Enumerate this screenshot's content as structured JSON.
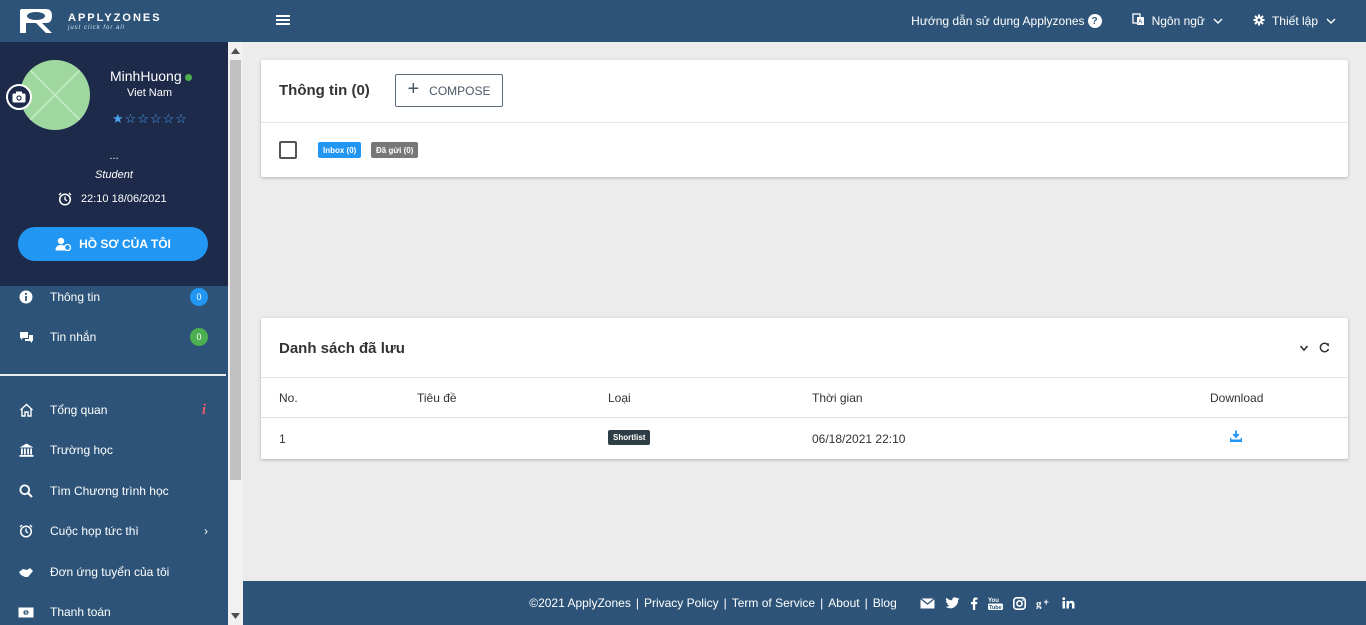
{
  "header": {
    "logo_name": "APPLYZONES",
    "logo_tagline": "just click for all",
    "guide_label": "Hướng dẫn sử dụng Applyzones",
    "language_label": "Ngôn ngữ",
    "settings_label": "Thiết lập"
  },
  "profile": {
    "name": "MinhHuong",
    "country": "Viet Nam",
    "rating": "★☆☆☆☆☆",
    "dots": "...",
    "role": "Student",
    "datetime": "22:10 18/06/2021",
    "button_label": "HỒ SƠ CỦA TÔI"
  },
  "sidebar": {
    "items": [
      {
        "label": "Thông tin",
        "badge": "0",
        "badge_color": "#2196f3"
      },
      {
        "label": "Tin nhắn",
        "badge": "0",
        "badge_color": "#4caf50"
      },
      {
        "label": "Tổng quan",
        "marker": "i"
      },
      {
        "label": "Trường học"
      },
      {
        "label": "Tìm Chương trình học"
      },
      {
        "label": "Cuộc họp tức thì",
        "arrow": "›"
      },
      {
        "label": "Đơn ứng tuyển của tôi"
      },
      {
        "label": "Thanh toán"
      }
    ]
  },
  "messages": {
    "title": "Thông tin (0)",
    "compose_label": "COMPOSE",
    "inbox_label": "Inbox (0)",
    "sent_label": "Đã gửi (0)"
  },
  "saved": {
    "title": "Danh sách đã lưu",
    "columns": [
      "No.",
      "Tiêu đề",
      "Loại",
      "Thời gian",
      "Download"
    ],
    "rows": [
      {
        "no": "1",
        "title": "",
        "type": "Shortlist",
        "time": "06/18/2021 22:10"
      }
    ]
  },
  "footer": {
    "copyright": "©2021 ApplyZones",
    "links": [
      "Privacy Policy",
      "Term of Service",
      "About",
      "Blog"
    ],
    "separator": "|"
  },
  "colors": {
    "brand": "#2d5478",
    "profile_bg": "#1d2a4a",
    "accent": "#2196f3",
    "online": "#4caf50",
    "marker": "#e85a6b"
  }
}
